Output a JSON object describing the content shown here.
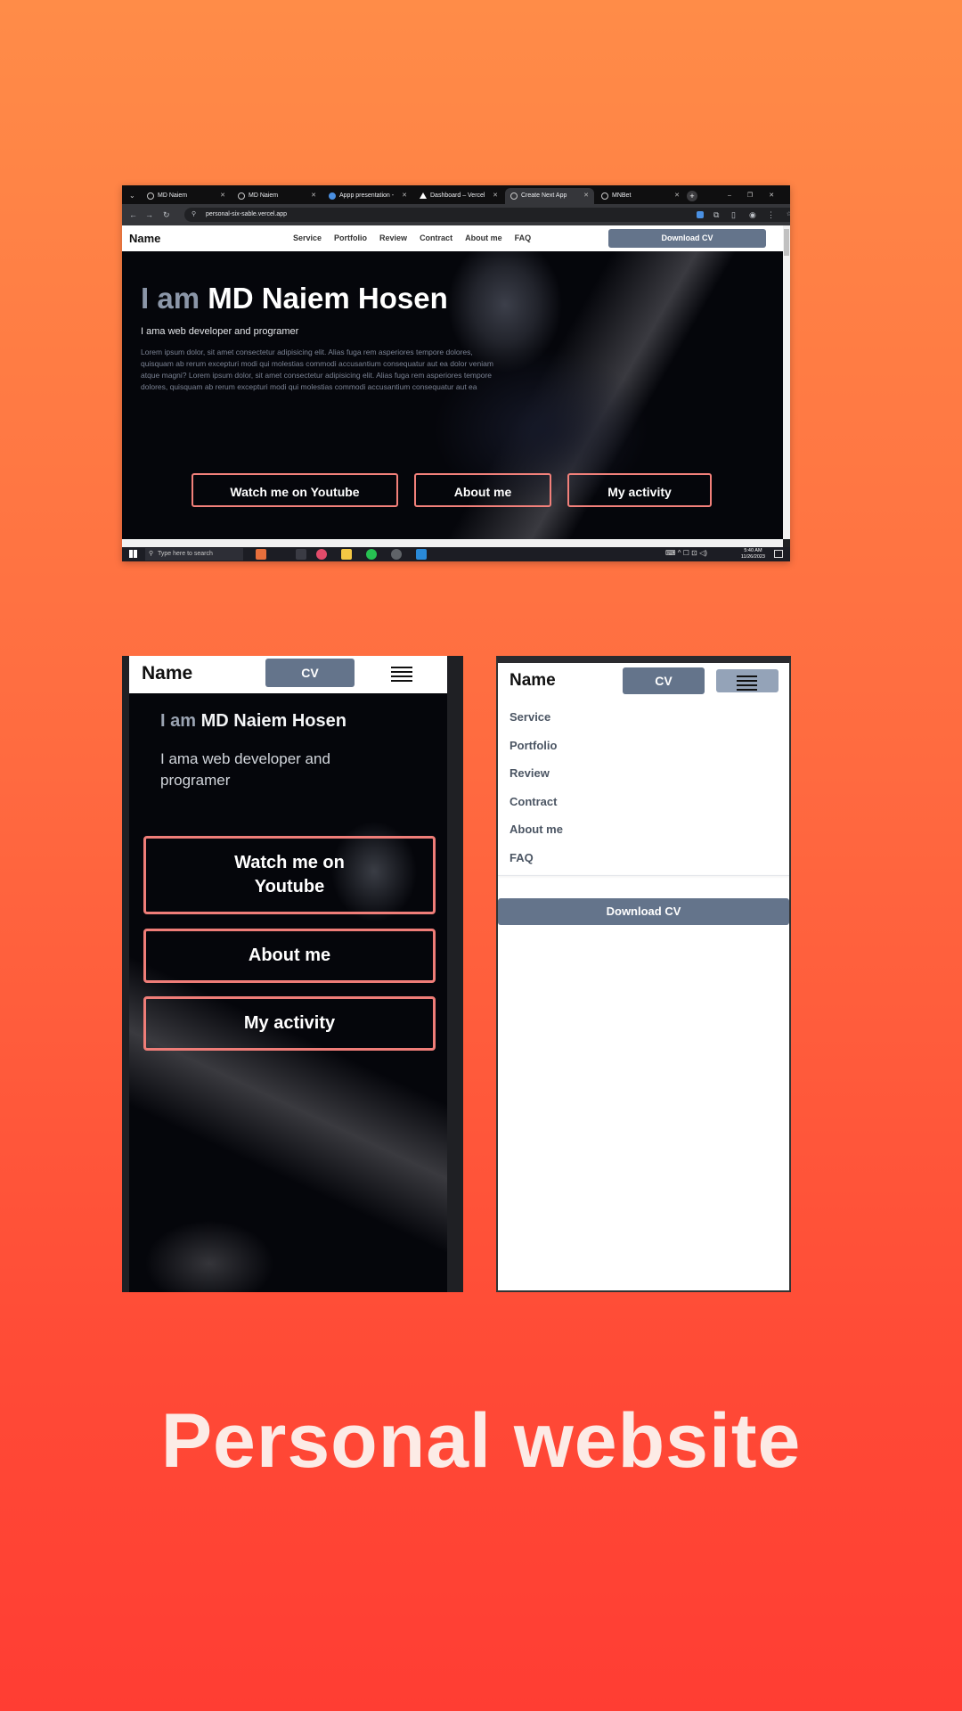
{
  "browser": {
    "tabs": [
      "MD Naiem",
      "MD Naiem",
      "Appp presentation -",
      "Dashboard – Vercel",
      "Create Next App",
      "MNBet"
    ],
    "active_tab": 4,
    "url": "personal-six-sable.vercel.app",
    "site": {
      "brand": "Name",
      "nav": [
        "Service",
        "Portfolio",
        "Review",
        "Contract",
        "About me",
        "FAQ"
      ],
      "download_cv": "Download CV",
      "heading_prefix": "I am",
      "heading_name": "MD Naiem Hosen",
      "subtitle": "I ama web developer and programer",
      "lorem": "Lorem ipsum dolor, sit amet consectetur adipisicing elit. Alias fuga rem asperiores tempore dolores, quisquam ab rerum excepturi modi qui molestias commodi accusantium consequatur aut ea dolor veniam atque magni? Lorem ipsum dolor, sit amet consectetur adipisicing elit. Alias fuga rem asperiores tempore dolores, quisquam ab rerum excepturi modi qui molestias commodi accusantium consequatur aut ea",
      "buttons": [
        "Watch me on Youtube",
        "About me",
        "My activity"
      ]
    },
    "taskbar": {
      "search_placeholder": "Type here to search",
      "time": "5:40 AM",
      "date": "11/26/2023"
    }
  },
  "mobile_home": {
    "brand": "Name",
    "cv": "CV",
    "heading_prefix": "I am",
    "heading_name": "MD Naiem Hosen",
    "subtitle": "I ama web developer and programer",
    "buttons": [
      "Watch me on Youtube",
      "About me",
      "My activity"
    ]
  },
  "mobile_menu": {
    "brand": "Name",
    "cv": "CV",
    "links": [
      "Service",
      "Portfolio",
      "Review",
      "Contract",
      "About me",
      "FAQ"
    ],
    "download_cv": "Download CV"
  },
  "caption": "Personal website",
  "colors": {
    "accent": "#64748b",
    "button_border": "#f2807a",
    "bg_top": "#ff8c48",
    "bg_bottom": "#ff3d33"
  }
}
